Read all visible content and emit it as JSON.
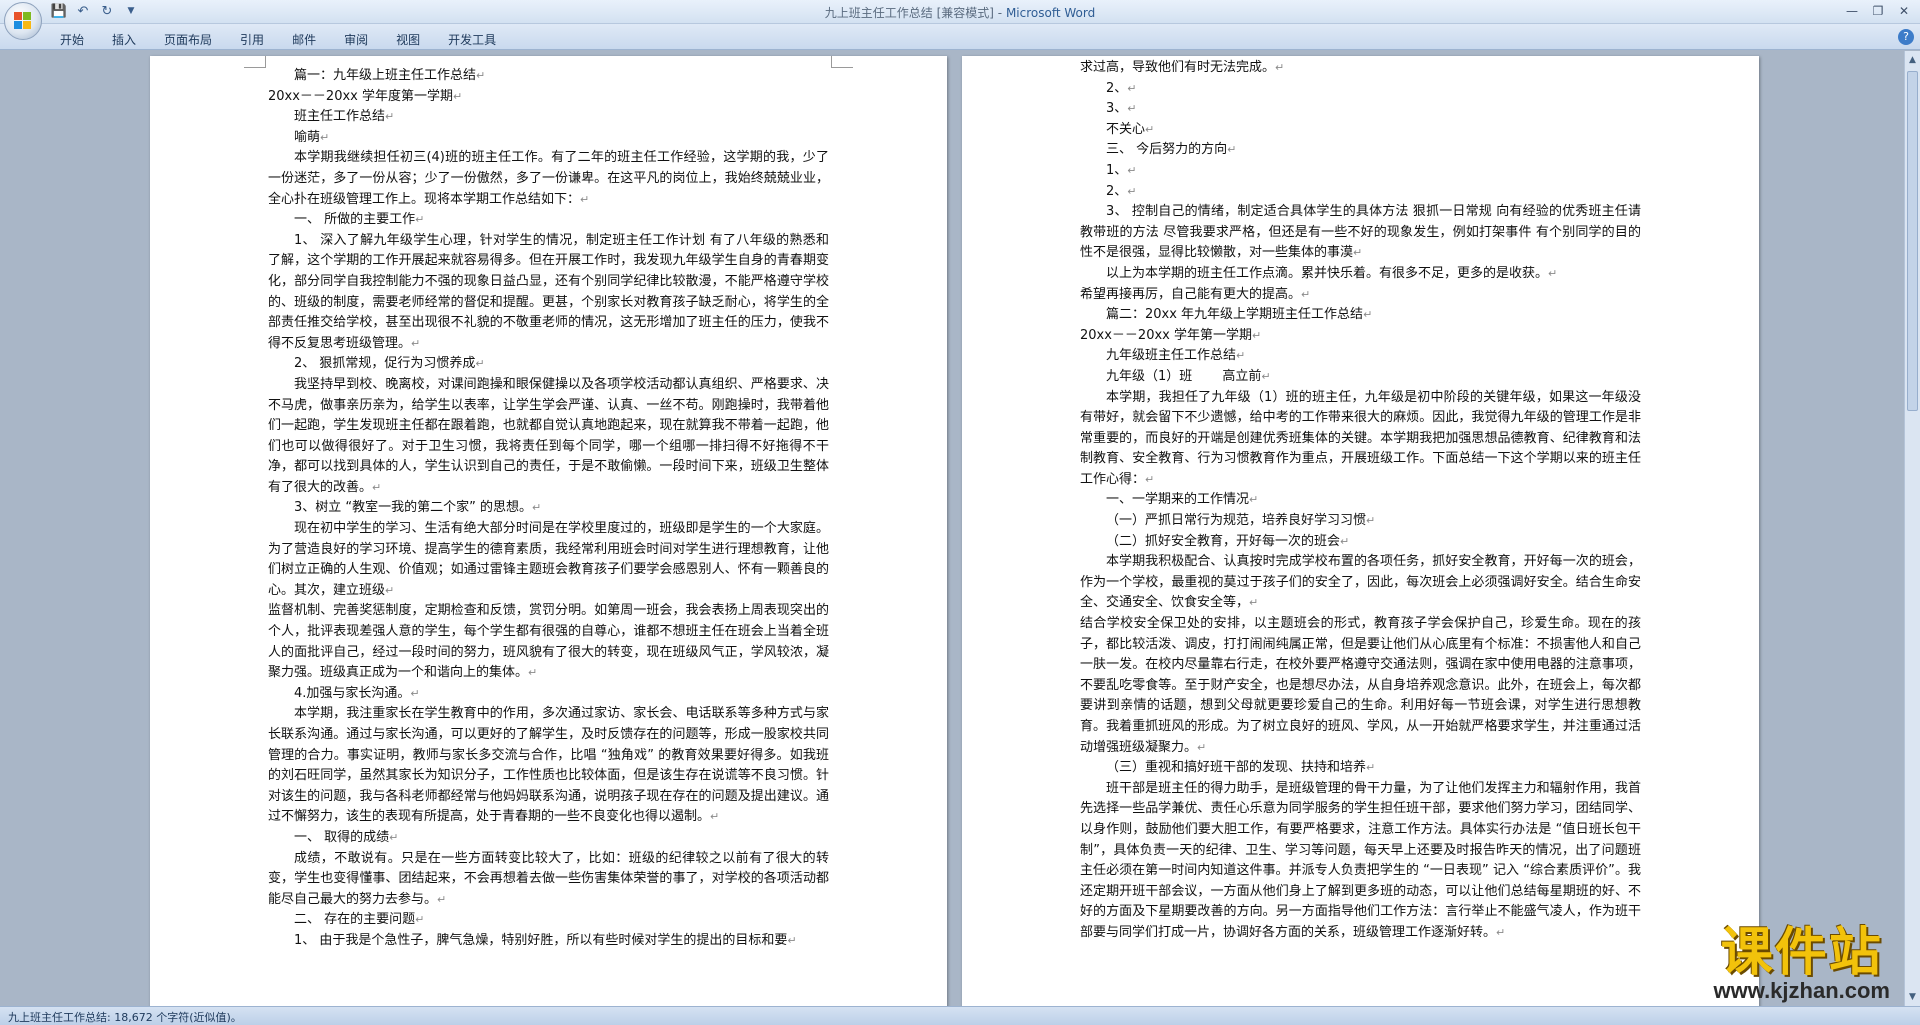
{
  "app": {
    "title_doc": "九上班主任工作总结 [兼容模式]",
    "title_sep": " - ",
    "title_app": "Microsoft Word"
  },
  "qat": {
    "save_icon": "save-icon",
    "undo_icon": "undo-icon",
    "redo_icon": "redo-icon"
  },
  "ribbon": {
    "tabs": [
      "开始",
      "插入",
      "页面布局",
      "引用",
      "邮件",
      "审阅",
      "视图",
      "开发工具"
    ]
  },
  "status": {
    "text": "九上班主任工作总结: 18,672 个字符(近似值)。"
  },
  "watermark": {
    "big": "课件站",
    "url": "www.kjzhan.com"
  },
  "doc": {
    "left": [
      {
        "t": "篇一：九年级上班主任工作总结",
        "i": true
      },
      {
        "t": "20xx－－20xx 学年度第一学期",
        "i": false
      },
      {
        "t": "班主任工作总结",
        "i": true
      },
      {
        "t": "喻萌",
        "i": true
      },
      {
        "t": "本学期我继续担任初三(4)班的班主任工作。有了二年的班主任工作经验，这学期的我，少了一份迷茫，多了一份从容；少了一份傲然，多了一份谦卑。在这平凡的岗位上，我始终兢兢业业，全心扑在班级管理工作上。现将本学期工作总结如下：",
        "i": true
      },
      {
        "t": "一、 所做的主要工作",
        "i": true
      },
      {
        "t": "1、 深入了解九年级学生心理，针对学生的情况，制定班主任工作计划 有了八年级的熟悉和了解，这个学期的工作开展起来就容易得多。但在开展工作时，我发现九年级学生自身的青春期变化，部分同学自我控制能力不强的现象日益凸显，还有个别同学纪律比较散漫，不能严格遵守学校的、班级的制度，需要老师经常的督促和提醒。更甚，个别家长对教育孩子缺乏耐心，将学生的全部责任推交给学校，甚至出现很不礼貌的不敬重老师的情况，这无形增加了班主任的压力，使我不得不反复思考班级管理。",
        "i": true
      },
      {
        "t": "2、 狠抓常规，促行为习惯养成",
        "i": true
      },
      {
        "t": "我坚持早到校、晚离校，对课间跑操和眼保健操以及各项学校活动都认真组织、严格要求、决不马虎，做事亲历亲为，给学生以表率，让学生学会严谨、认真、一丝不苟。刚跑操时，我带着他们一起跑，学生发现班主任都在跟着跑，也就都自觉认真地跑起来，现在就算我不带着一起跑，他们也可以做得很好了。对于卫生习惯，我将责任到每个同学，哪一个组哪一排扫得不好拖得不干净，都可以找到具体的人，学生认识到自己的责任，于是不敢偷懒。一段时间下来，班级卫生整体有了很大的改善。",
        "i": true
      },
      {
        "t": "3、树立 “教室一我的第二个家” 的思想。",
        "i": true
      },
      {
        "t": "现在初中学生的学习、生活有绝大部分时间是在学校里度过的，班级即是学生的一个大家庭。为了营造良好的学习环境、提高学生的德育素质，我经常利用班会时间对学生进行理想教育，让他们树立正确的人生观、价值观；如通过雷锋主题班会教育孩子们要学会感恩别人、怀有一颗善良的心。其次，建立班级",
        "i": true
      },
      {
        "t": "监督机制、完善奖惩制度，定期检查和反馈，赏罚分明。如第周一班会，我会表扬上周表现突出的个人，批评表现差强人意的学生，每个学生都有很强的自尊心，谁都不想班主任在班会上当着全班人的面批评自己，经过一段时间的努力，班风貌有了很大的转变，现在班级风气正，学风较浓，凝聚力强。班级真正成为一个和谐向上的集体。",
        "i": false
      },
      {
        "t": "4.加强与家长沟通。",
        "i": true
      },
      {
        "t": "本学期，我注重家长在学生教育中的作用，多次通过家访、家长会、电话联系等多种方式与家长联系沟通。通过与家长沟通，可以更好的了解学生，及时反馈存在的问题等，形成一股家校共同管理的合力。事实证明，教师与家长多交流与合作，比唱 “独角戏” 的教育效果要好得多。如我班的刘石旺同学，虽然其家长为知识分子，工作性质也比较体面，但是该生存在说谎等不良习惯。针对该生的问题，我与各科老师都经常与他妈妈联系沟通，说明孩子现在存在的问题及提出建议。通过不懈努力，该生的表现有所提高，处于青春期的一些不良变化也得以遏制。",
        "i": true
      },
      {
        "t": "一、 取得的成绩",
        "i": true
      },
      {
        "t": "成绩，不敢说有。只是在一些方面转变比较大了，比如：班级的纪律较之以前有了很大的转变，学生也变得懂事、团结起来，不会再想着去做一些伤害集体荣誉的事了，对学校的各项活动都能尽自己最大的努力去参与。",
        "i": true
      },
      {
        "t": "二、 存在的主要问题",
        "i": true
      },
      {
        "t": "1、 由于我是个急性子，脾气急燥，特别好胜，所以有些时候对学生的提出的目标和要",
        "i": true
      }
    ],
    "right": [
      {
        "t": "求过高，导致他们有时无法完成。",
        "i": false
      },
      {
        "t": "2、",
        "i": true
      },
      {
        "t": "3、",
        "i": true
      },
      {
        "t": "不关心",
        "i": true
      },
      {
        "t": "三、 今后努力的方向",
        "i": true
      },
      {
        "t": "1、",
        "i": true
      },
      {
        "t": "2、",
        "i": true
      },
      {
        "t": "3、 控制自己的情绪，制定适合具体学生的具体方法 狠抓一日常规 向有经验的优秀班主任请教带班的方法 尽管我要求严格，但还是有一些不好的现象发生，例如打架事件 有个别同学的目的性不是很强，显得比较懒散，对一些集体的事漠",
        "i": true
      },
      {
        "t": "以上为本学期的班主任工作点滴。累并快乐着。有很多不足，更多的是收获。",
        "i": true
      },
      {
        "t": "希望再接再厉，自己能有更大的提高。",
        "i": false
      },
      {
        "t": "篇二：20xx 年九年级上学期班主任工作总结",
        "i": true
      },
      {
        "t": "20xx－－20xx 学年第一学期",
        "i": false
      },
      {
        "t": "九年级班主任工作总结",
        "i": true
      },
      {
        "t": "九年级（1）班　　 高立前",
        "i": true
      },
      {
        "t": "本学期，我担任了九年级（1）班的班主任，九年级是初中阶段的关键年级，如果这一年级没有带好，就会留下不少遗憾，给中考的工作带来很大的麻烦。因此，我觉得九年级的管理工作是非常重要的，而良好的开端是创建优秀班集体的关键。本学期我把加强思想品德教育、纪律教育和法制教育、安全教育、行为习惯教育作为重点，开展班级工作。下面总结一下这个学期以来的班主任工作心得：",
        "i": true
      },
      {
        "t": "一、一学期来的工作情况",
        "i": true
      },
      {
        "t": "（一）严抓日常行为规范，培养良好学习习惯",
        "i": true
      },
      {
        "t": "（二）抓好安全教育，开好每一次的班会",
        "i": true
      },
      {
        "t": "本学期我积极配合、认真按时完成学校布置的各项任务，抓好安全教育，开好每一次的班会，作为一个学校，最重视的莫过于孩子们的安全了，因此，每次班会上必须强调好安全。结合生命安全、交通安全、饮食安全等，",
        "i": true
      },
      {
        "t": "结合学校安全保卫处的安排，以主题班会的形式，教育孩子学会保护自己，珍爱生命。现在的孩子，都比较活泼、调皮，打打闹闹纯属正常，但是要让他们从心底里有个标准：不损害他人和自己一肤一发。在校内尽量靠右行走，在校外要严格遵守交通法则，强调在家中使用电器的注意事项，不要乱吃零食等。至于财产安全，也是想尽办法，从自身培养观念意识。此外，在班会上，每次都要讲到亲情的话题，想到父母就更要珍爱自己的生命。利用好每一节班会课，对学生进行思想教育。我着重抓班风的形成。为了树立良好的班风、学风，从一开始就严格要求学生，并注重通过活动增强班级凝聚力。",
        "i": false
      },
      {
        "t": "（三）重视和搞好班干部的发现、扶持和培养",
        "i": true
      },
      {
        "t": "班干部是班主任的得力助手，是班级管理的骨干力量，为了让他们发挥主力和辐射作用，我首先选择一些品学兼优、责任心乐意为同学服务的学生担任班干部，要求他们努力学习，团结同学、以身作则，鼓励他们要大胆工作，有要严格要求，注意工作方法。具体实行办法是 “值日班长包干制”，具体负责一天的纪律、卫生、学习等问题，每天早上还要及时报告昨天的情况，出了问题班主任必须在第一时间内知道这件事。并派专人负责把学生的 “一日表现” 记入 “综合素质评价”。我还定期开班干部会议，一方面从他们身上了解到更多班的动态，可以让他们总结每星期班的好、不好的方面及下星期要改善的方向。另一方面指导他们工作方法：言行举止不能盛气凌人，作为班干部要与同学们打成一片，协调好各方面的关系，班级管理工作逐渐好转。",
        "i": true
      }
    ]
  }
}
